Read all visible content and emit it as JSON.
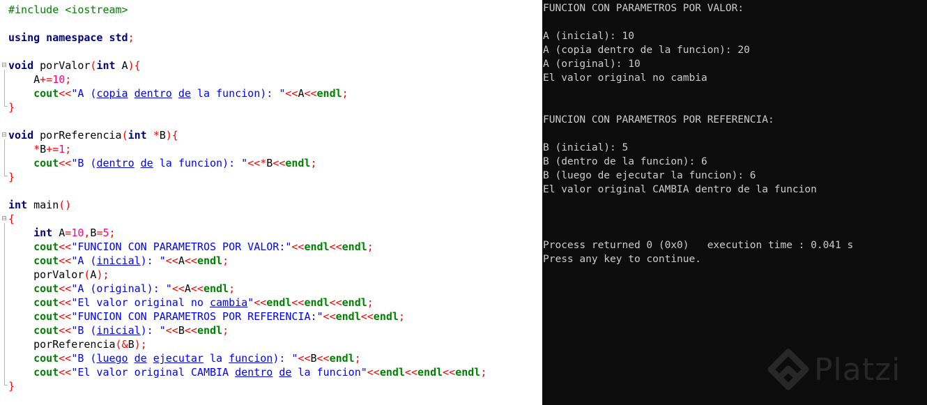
{
  "editor": {
    "lines": [
      [
        {
          "t": "#include <iostream>",
          "c": "t-pp"
        }
      ],
      [],
      [
        {
          "t": "using namespace std",
          "c": "t-kw"
        },
        {
          "t": ";",
          "c": "t-op"
        }
      ],
      [],
      [
        {
          "t": "void",
          "c": "t-kw"
        },
        {
          "t": " porValor",
          "c": "t-id"
        },
        {
          "t": "(",
          "c": "t-op"
        },
        {
          "t": "int",
          "c": "t-kw"
        },
        {
          "t": " A",
          "c": "t-id"
        },
        {
          "t": "){",
          "c": "t-op"
        }
      ],
      [
        {
          "t": "    A",
          "c": "t-id"
        },
        {
          "t": "+=",
          "c": "t-op"
        },
        {
          "t": "10",
          "c": "t-num"
        },
        {
          "t": ";",
          "c": "t-op"
        }
      ],
      [
        {
          "t": "    ",
          "c": "t-id"
        },
        {
          "t": "cout",
          "c": "t-std"
        },
        {
          "t": "<<",
          "c": "t-op"
        },
        {
          "t": "\"A (",
          "c": "t-str"
        },
        {
          "t": "copia",
          "c": "t-str t-sp"
        },
        {
          "t": " ",
          "c": "t-str"
        },
        {
          "t": "dentro",
          "c": "t-str t-sp"
        },
        {
          "t": " ",
          "c": "t-str"
        },
        {
          "t": "de",
          "c": "t-str t-sp"
        },
        {
          "t": " la funcion): \"",
          "c": "t-str"
        },
        {
          "t": "<<",
          "c": "t-op"
        },
        {
          "t": "A",
          "c": "t-id"
        },
        {
          "t": "<<",
          "c": "t-op"
        },
        {
          "t": "endl",
          "c": "t-std"
        },
        {
          "t": ";",
          "c": "t-op"
        }
      ],
      [
        {
          "t": "}",
          "c": "t-op"
        }
      ],
      [],
      [
        {
          "t": "void",
          "c": "t-kw"
        },
        {
          "t": " porReferencia",
          "c": "t-id"
        },
        {
          "t": "(",
          "c": "t-op"
        },
        {
          "t": "int",
          "c": "t-kw"
        },
        {
          "t": " ",
          "c": "t-id"
        },
        {
          "t": "*",
          "c": "t-op"
        },
        {
          "t": "B",
          "c": "t-id"
        },
        {
          "t": "){",
          "c": "t-op"
        }
      ],
      [
        {
          "t": "    ",
          "c": "t-id"
        },
        {
          "t": "*",
          "c": "t-op"
        },
        {
          "t": "B",
          "c": "t-id"
        },
        {
          "t": "+=",
          "c": "t-op"
        },
        {
          "t": "1",
          "c": "t-num"
        },
        {
          "t": ";",
          "c": "t-op"
        }
      ],
      [
        {
          "t": "    ",
          "c": "t-id"
        },
        {
          "t": "cout",
          "c": "t-std"
        },
        {
          "t": "<<",
          "c": "t-op"
        },
        {
          "t": "\"B (",
          "c": "t-str"
        },
        {
          "t": "dentro",
          "c": "t-str t-sp"
        },
        {
          "t": " ",
          "c": "t-str"
        },
        {
          "t": "de",
          "c": "t-str t-sp"
        },
        {
          "t": " la funcion): \"",
          "c": "t-str"
        },
        {
          "t": "<<*",
          "c": "t-op"
        },
        {
          "t": "B",
          "c": "t-id"
        },
        {
          "t": "<<",
          "c": "t-op"
        },
        {
          "t": "endl",
          "c": "t-std"
        },
        {
          "t": ";",
          "c": "t-op"
        }
      ],
      [
        {
          "t": "}",
          "c": "t-op"
        }
      ],
      [],
      [
        {
          "t": "int",
          "c": "t-kw"
        },
        {
          "t": " main",
          "c": "t-id"
        },
        {
          "t": "()",
          "c": "t-op"
        }
      ],
      [
        {
          "t": "{",
          "c": "t-op"
        }
      ],
      [
        {
          "t": "    ",
          "c": "t-id"
        },
        {
          "t": "int",
          "c": "t-kw"
        },
        {
          "t": " A",
          "c": "t-id"
        },
        {
          "t": "=",
          "c": "t-op"
        },
        {
          "t": "10",
          "c": "t-num"
        },
        {
          "t": ",",
          "c": "t-op"
        },
        {
          "t": "B",
          "c": "t-id"
        },
        {
          "t": "=",
          "c": "t-op"
        },
        {
          "t": "5",
          "c": "t-num"
        },
        {
          "t": ";",
          "c": "t-op"
        }
      ],
      [
        {
          "t": "    ",
          "c": "t-id"
        },
        {
          "t": "cout",
          "c": "t-std"
        },
        {
          "t": "<<",
          "c": "t-op"
        },
        {
          "t": "\"FUNCION CON PARAMETROS POR VALOR:\"",
          "c": "t-str"
        },
        {
          "t": "<<",
          "c": "t-op"
        },
        {
          "t": "endl",
          "c": "t-std"
        },
        {
          "t": "<<",
          "c": "t-op"
        },
        {
          "t": "endl",
          "c": "t-std"
        },
        {
          "t": ";",
          "c": "t-op"
        }
      ],
      [
        {
          "t": "    ",
          "c": "t-id"
        },
        {
          "t": "cout",
          "c": "t-std"
        },
        {
          "t": "<<",
          "c": "t-op"
        },
        {
          "t": "\"A (",
          "c": "t-str"
        },
        {
          "t": "inicial",
          "c": "t-str t-sp"
        },
        {
          "t": "): \"",
          "c": "t-str"
        },
        {
          "t": "<<",
          "c": "t-op"
        },
        {
          "t": "A",
          "c": "t-id"
        },
        {
          "t": "<<",
          "c": "t-op"
        },
        {
          "t": "endl",
          "c": "t-std"
        },
        {
          "t": ";",
          "c": "t-op"
        }
      ],
      [
        {
          "t": "    porValor",
          "c": "t-id"
        },
        {
          "t": "(",
          "c": "t-op"
        },
        {
          "t": "A",
          "c": "t-id"
        },
        {
          "t": ");",
          "c": "t-op"
        }
      ],
      [
        {
          "t": "    ",
          "c": "t-id"
        },
        {
          "t": "cout",
          "c": "t-std"
        },
        {
          "t": "<<",
          "c": "t-op"
        },
        {
          "t": "\"A (original): \"",
          "c": "t-str"
        },
        {
          "t": "<<",
          "c": "t-op"
        },
        {
          "t": "A",
          "c": "t-id"
        },
        {
          "t": "<<",
          "c": "t-op"
        },
        {
          "t": "endl",
          "c": "t-std"
        },
        {
          "t": ";",
          "c": "t-op"
        }
      ],
      [
        {
          "t": "    ",
          "c": "t-id"
        },
        {
          "t": "cout",
          "c": "t-std"
        },
        {
          "t": "<<",
          "c": "t-op"
        },
        {
          "t": "\"El valor original no ",
          "c": "t-str"
        },
        {
          "t": "cambia",
          "c": "t-str t-sp"
        },
        {
          "t": "\"",
          "c": "t-str"
        },
        {
          "t": "<<",
          "c": "t-op"
        },
        {
          "t": "endl",
          "c": "t-std"
        },
        {
          "t": "<<",
          "c": "t-op"
        },
        {
          "t": "endl",
          "c": "t-std"
        },
        {
          "t": "<<",
          "c": "t-op"
        },
        {
          "t": "endl",
          "c": "t-std"
        },
        {
          "t": ";",
          "c": "t-op"
        }
      ],
      [
        {
          "t": "    ",
          "c": "t-id"
        },
        {
          "t": "cout",
          "c": "t-std"
        },
        {
          "t": "<<",
          "c": "t-op"
        },
        {
          "t": "\"FUNCION CON PARAMETROS POR REFERENCIA:\"",
          "c": "t-str"
        },
        {
          "t": "<<",
          "c": "t-op"
        },
        {
          "t": "endl",
          "c": "t-std"
        },
        {
          "t": "<<",
          "c": "t-op"
        },
        {
          "t": "endl",
          "c": "t-std"
        },
        {
          "t": ";",
          "c": "t-op"
        }
      ],
      [
        {
          "t": "    ",
          "c": "t-id"
        },
        {
          "t": "cout",
          "c": "t-std"
        },
        {
          "t": "<<",
          "c": "t-op"
        },
        {
          "t": "\"B (",
          "c": "t-str"
        },
        {
          "t": "inicial",
          "c": "t-str t-sp"
        },
        {
          "t": "): \"",
          "c": "t-str"
        },
        {
          "t": "<<",
          "c": "t-op"
        },
        {
          "t": "B",
          "c": "t-id"
        },
        {
          "t": "<<",
          "c": "t-op"
        },
        {
          "t": "endl",
          "c": "t-std"
        },
        {
          "t": ";",
          "c": "t-op"
        }
      ],
      [
        {
          "t": "    porReferencia",
          "c": "t-id"
        },
        {
          "t": "(&",
          "c": "t-op"
        },
        {
          "t": "B",
          "c": "t-id"
        },
        {
          "t": ");",
          "c": "t-op"
        }
      ],
      [
        {
          "t": "    ",
          "c": "t-id"
        },
        {
          "t": "cout",
          "c": "t-std"
        },
        {
          "t": "<<",
          "c": "t-op"
        },
        {
          "t": "\"B (",
          "c": "t-str"
        },
        {
          "t": "luego",
          "c": "t-str t-sp"
        },
        {
          "t": " ",
          "c": "t-str"
        },
        {
          "t": "de",
          "c": "t-str t-sp"
        },
        {
          "t": " ",
          "c": "t-str"
        },
        {
          "t": "ejecutar",
          "c": "t-str t-sp"
        },
        {
          "t": " la ",
          "c": "t-str"
        },
        {
          "t": "funcion",
          "c": "t-str t-sp"
        },
        {
          "t": "): \"",
          "c": "t-str"
        },
        {
          "t": "<<",
          "c": "t-op"
        },
        {
          "t": "B",
          "c": "t-id"
        },
        {
          "t": "<<",
          "c": "t-op"
        },
        {
          "t": "endl",
          "c": "t-std"
        },
        {
          "t": ";",
          "c": "t-op"
        }
      ],
      [
        {
          "t": "    ",
          "c": "t-id"
        },
        {
          "t": "cout",
          "c": "t-std"
        },
        {
          "t": "<<",
          "c": "t-op"
        },
        {
          "t": "\"El valor original CAMBIA ",
          "c": "t-str"
        },
        {
          "t": "dentro",
          "c": "t-str t-sp"
        },
        {
          "t": " ",
          "c": "t-str"
        },
        {
          "t": "de",
          "c": "t-str t-sp"
        },
        {
          "t": " la funcion\"",
          "c": "t-str"
        },
        {
          "t": "<<",
          "c": "t-op"
        },
        {
          "t": "endl",
          "c": "t-std"
        },
        {
          "t": "<<",
          "c": "t-op"
        },
        {
          "t": "endl",
          "c": "t-std"
        },
        {
          "t": "<<",
          "c": "t-op"
        },
        {
          "t": "endl",
          "c": "t-std"
        },
        {
          "t": ";",
          "c": "t-op"
        }
      ],
      [
        {
          "t": "}",
          "c": "t-op"
        }
      ]
    ]
  },
  "console": {
    "lines": [
      "FUNCION CON PARAMETROS POR VALOR:",
      "",
      "A (inicial): 10",
      "A (copia dentro de la funcion): 20",
      "A (original): 10",
      "El valor original no cambia",
      "",
      "",
      "FUNCION CON PARAMETROS POR REFERENCIA:",
      "",
      "B (inicial): 5",
      "B (dentro de la funcion): 6",
      "B (luego de ejecutar la funcion): 6",
      "El valor original CAMBIA dentro de la funcion",
      "",
      "",
      "",
      "Process returned 0 (0x0)   execution time : 0.041 s",
      "Press any key to continue."
    ]
  },
  "watermark": {
    "text": "Platzi"
  }
}
